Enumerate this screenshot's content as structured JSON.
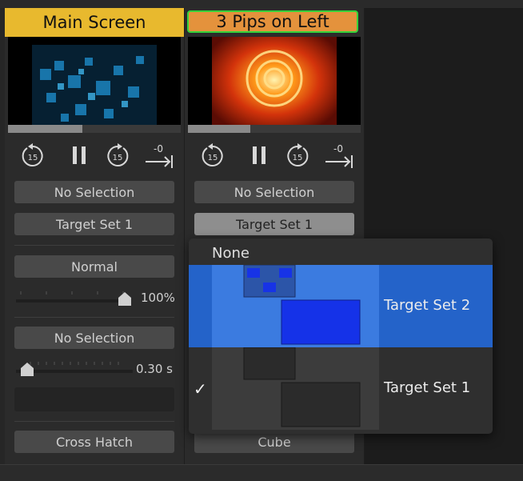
{
  "columns": [
    {
      "header": "Main Screen",
      "header_color": "#e8b92e",
      "progress": 0.43,
      "controls": {
        "back_label": "15",
        "fwd_label": "15",
        "end_label": "-0"
      },
      "selection": "No Selection",
      "target_set": "Target Set 1",
      "blend_mode": "Normal",
      "opacity_value": "100%",
      "opacity_level": 1.0,
      "transition_select": "No Selection",
      "duration_value": "0.30 s",
      "transition": "Cross Hatch"
    },
    {
      "header": "3 Pips on Left",
      "header_color": "#e4923c",
      "progress": 0.36,
      "controls": {
        "back_label": "15",
        "fwd_label": "15",
        "end_label": "-0"
      },
      "selection": "No Selection",
      "target_set": "Target Set 1",
      "transition": "Cube"
    }
  ],
  "dropdown": {
    "none_label": "None",
    "items": [
      {
        "label": "Target Set 2",
        "selected": true,
        "checked": false
      },
      {
        "label": "Target Set 1",
        "selected": false,
        "checked": true
      }
    ],
    "check_glyph": "✓"
  },
  "colors": {
    "accent": "#2463c9",
    "active_border": "#35d33a"
  }
}
